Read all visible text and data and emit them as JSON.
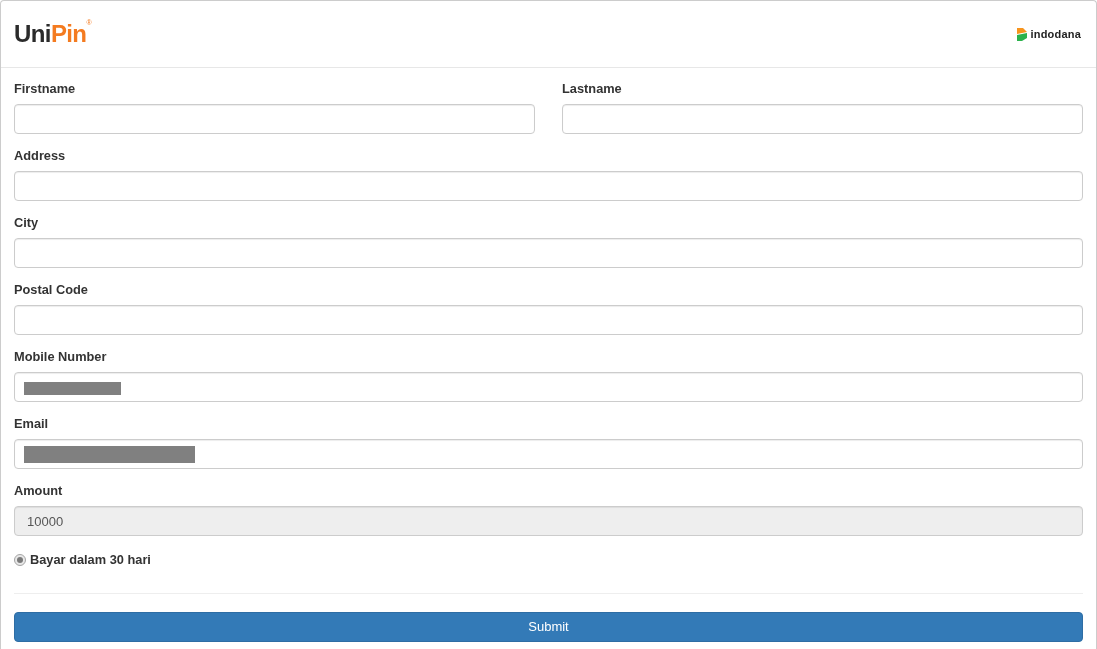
{
  "header": {
    "logo": {
      "primary": "Uni",
      "accent": "Pin",
      "registered_mark": "®"
    },
    "partner_logo": {
      "text": "indodana"
    }
  },
  "form": {
    "rows": [
      {
        "fields": [
          {
            "label": "Firstname",
            "disabled": false,
            "redacted": false
          },
          {
            "label": "Lastname",
            "disabled": false,
            "redacted": false
          }
        ]
      },
      {
        "fields": [
          {
            "label": "Address",
            "disabled": false,
            "redacted": false
          }
        ]
      },
      {
        "fields": [
          {
            "label": "City",
            "disabled": false,
            "redacted": false
          }
        ]
      },
      {
        "fields": [
          {
            "label": "Postal Code",
            "disabled": false,
            "redacted": false
          }
        ]
      },
      {
        "fields": [
          {
            "label": "Mobile Number",
            "disabled": false,
            "redacted": true
          }
        ]
      },
      {
        "fields": [
          {
            "label": "Email",
            "disabled": false,
            "redacted": true
          }
        ]
      },
      {
        "fields": [
          {
            "label": "Amount",
            "value": "10000",
            "disabled": true,
            "redacted": false
          }
        ]
      }
    ],
    "payment_option": {
      "label": "Bayar dalam 30 hari",
      "checked": true,
      "disabled": true
    },
    "submit_button": {
      "label": "Submit"
    }
  }
}
